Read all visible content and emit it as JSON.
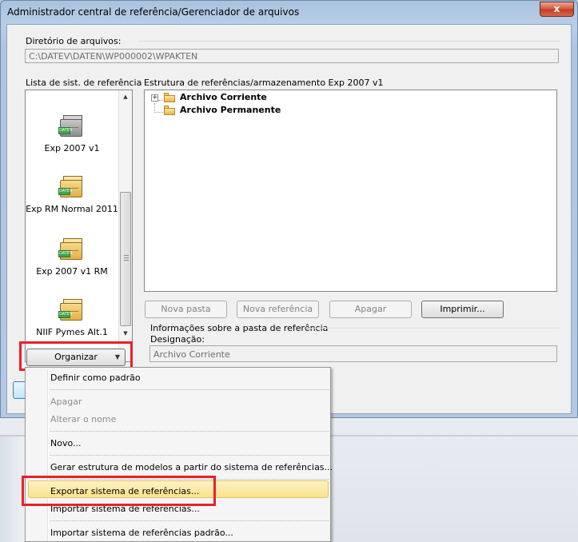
{
  "window": {
    "title": "Administrador central de referência/Gerenciador de arquivos",
    "close_symbol": "x"
  },
  "directory": {
    "label": "Diretório de arquivos:",
    "value": "C:\\DATEV\\DATEN\\WP000002\\WPAKTEN"
  },
  "ref_list": {
    "label": "Lista de sist. de referência",
    "items": [
      {
        "label": "Exp 2007 v1",
        "icon": "gray-drawer-datev-icon"
      },
      {
        "label": "Exp RM Normal 2011",
        "icon": "gold-drawer-datev-icon"
      },
      {
        "label": "Exp 2007 v1 RM",
        "icon": "gold-drawer-datev-icon"
      },
      {
        "label": "NIIF Pymes Alt.1",
        "icon": "gold-drawer-datev-icon"
      }
    ],
    "icon_badge": "DATEV",
    "organize_button": "Organizar"
  },
  "structure": {
    "label": "Estrutura de referências/armazenamento Exp 2007 v1",
    "nodes": [
      {
        "label": "Archivo Corriente",
        "expander": "+"
      },
      {
        "label": "Archivo Permanente"
      }
    ]
  },
  "actions": {
    "new_folder": "Nova pasta",
    "new_reference": "Nova referência",
    "delete": "Apagar",
    "print": "Imprimir..."
  },
  "info": {
    "group_label": "Informações sobre a pasta de referência",
    "designation_label": "Designação:",
    "designation_value": "Archivo Corriente"
  },
  "context_menu": {
    "items": [
      {
        "label": "Definir como padrão",
        "enabled": true
      },
      {
        "label": "Apagar",
        "enabled": false
      },
      {
        "label": "Alterar o nome",
        "enabled": false
      },
      {
        "label": "Novo...",
        "enabled": true
      },
      {
        "label": "Gerar estrutura de modelos a partir do sistema de referências...",
        "enabled": true
      },
      {
        "label": "Exportar sistema de referências...",
        "enabled": true,
        "highlighted": true
      },
      {
        "label": "Importar sistema de referências...",
        "enabled": true
      },
      {
        "label": "Importar sistema de referências padrão...",
        "enabled": true
      }
    ]
  },
  "colors": {
    "highlight_box": "#e8212a",
    "menu_hover": "#fbe38c"
  }
}
